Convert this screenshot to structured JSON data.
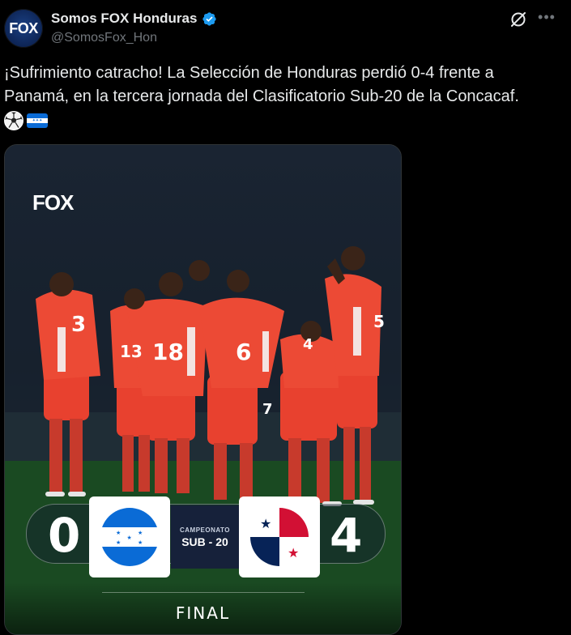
{
  "author": {
    "display_name": "Somos FOX Honduras",
    "handle": "@SomosFox_Hon",
    "avatar_text": "FOX",
    "verified": true
  },
  "actions": {
    "grok_icon": "grok-icon",
    "more_icon": "more-icon"
  },
  "tweet": {
    "text": "¡Sufrimiento catracho! La Selección de Honduras perdió 0-4 frente a Panamá, en la tercera jornada del Clasificatorio Sub-20 de la Concacaf.",
    "emojis": [
      "soccer-ball-emoji",
      "honduras-flag-emoji"
    ]
  },
  "media": {
    "logo": "FOX",
    "home_score": "0",
    "away_score": "4",
    "competition_label": "CAMPEONATO",
    "competition_name": "SUB - 20",
    "status": "FINAL",
    "jersey_numbers": [
      "3",
      "13",
      "18",
      "6",
      "7",
      "4",
      "5"
    ]
  },
  "colors": {
    "background": "#000000",
    "text_primary": "#e7e9ea",
    "text_secondary": "#71767b",
    "verified_blue": "#1d9bf0",
    "honduras_blue": "#0a6bd6",
    "panama_red": "#d21034",
    "panama_blue": "#072357",
    "jersey_red": "#e8412f"
  }
}
